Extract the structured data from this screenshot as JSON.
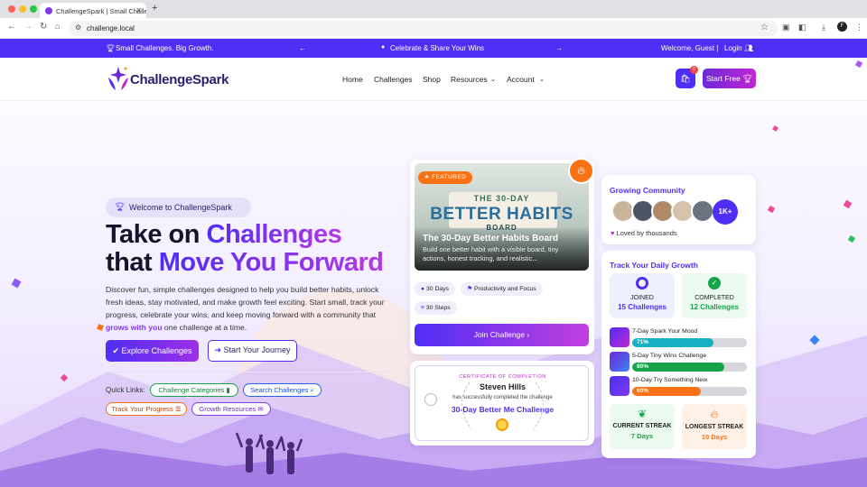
{
  "browser": {
    "tab_title": "ChallengeSpark | Small Challe",
    "url": "challenge.local"
  },
  "announce": {
    "left": "Small Challenges. Big Growth.",
    "center": "Celebrate & Share Your Wins",
    "welcome": "Welcome, Guest |",
    "login": "Login"
  },
  "header": {
    "logo": "ChallengeSpark",
    "nav": [
      "Home",
      "Challenges",
      "Shop",
      "Resources",
      "Account"
    ],
    "cart_count": "0",
    "start_free": "Start Free"
  },
  "hero": {
    "badge": "Welcome to ChallengeSpark",
    "headline_1a": "Take on ",
    "headline_1b": "Challenges",
    "headline_2a": "that ",
    "headline_2b": "Move You Forward",
    "paragraph_a": "Discover fun, simple challenges designed to help you build better habits, unlock fresh ideas, stay motivated, and make growth feel exciting. Start small, track your progress, celebrate your wins, and keep moving forward with a community that ",
    "paragraph_hl": "grows with you",
    "paragraph_b": " one challenge at a time.",
    "explore": "Explore Challenges",
    "journey": "Start Your Journey",
    "quick_links_label": "Quick Links:",
    "quick_links": [
      "Challenge Categories",
      "Search Challenges",
      "Track Your Progress",
      "Growth Resources"
    ]
  },
  "featured": {
    "badge": "FEATURED",
    "image_line1": "THE 30-DAY",
    "image_line2": "BETTER HABITS",
    "image_line3": "BOARD",
    "title": "The 30-Day Better Habits Board",
    "description": "Build one better habit with a visible board, tiny actions, honest tracking, and realistic...",
    "tags": [
      "30 Days",
      "Productivity and Focus",
      "30 Steps"
    ],
    "join": "Join Challenge"
  },
  "certificate": {
    "heading": "CERTIFICATE OF COMPLETION",
    "name": "Steven Hills",
    "text": "has successfully completed the challenge",
    "challenge": "30-Day Better Me Challenge"
  },
  "community": {
    "title": "Growing Community",
    "count": "1K+",
    "loved": "Loved by thousands"
  },
  "progress": {
    "title": "Track Your Daily Growth",
    "joined_label": "JOINED",
    "joined_value": "15 Challenges",
    "completed_label": "COMPLETED",
    "completed_value": "12 Challenges",
    "items": [
      {
        "label": "7-Day Spark Your Mood",
        "percent": 71,
        "percent_text": "71%",
        "color": "#16b1c4"
      },
      {
        "label": "5-Day Tiny Wins Challenge",
        "percent": 80,
        "percent_text": "80%",
        "color": "#16a34a"
      },
      {
        "label": "10-Day Try Something New",
        "percent": 60,
        "percent_text": "60%",
        "color": "#f97316"
      }
    ],
    "current_label": "CURRENT STREAK",
    "current_value": "7 Days",
    "longest_label": "LONGEST STREAK",
    "longest_value": "10 Days"
  },
  "colors": {
    "primary": "#4f2ef5",
    "accent": "#c026d3",
    "orange": "#f97316",
    "green": "#16a34a"
  }
}
